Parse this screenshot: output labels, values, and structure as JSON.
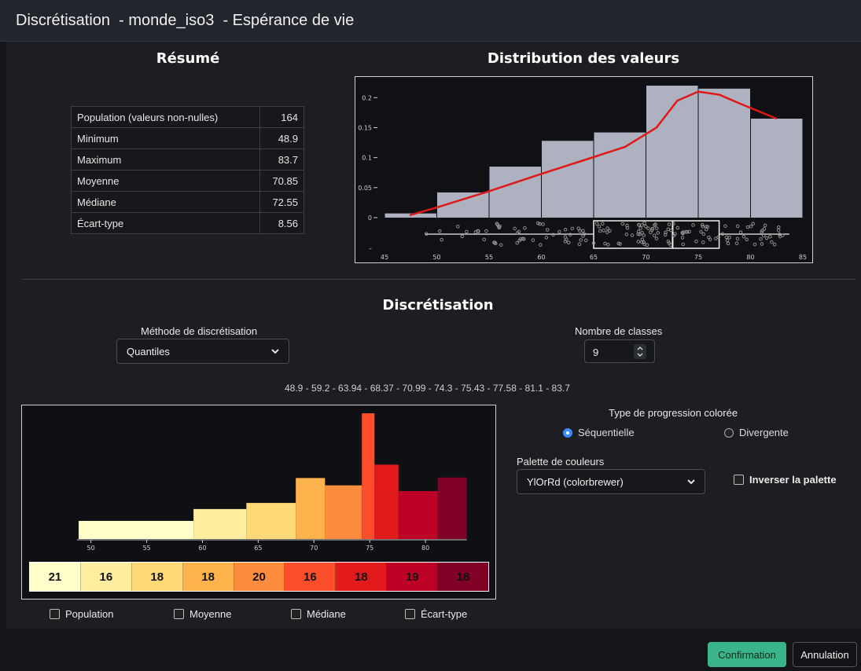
{
  "dialog": {
    "title": "Discrétisation  - monde_iso3  - Espérance de vie"
  },
  "summary": {
    "heading": "Résumé",
    "rows": [
      {
        "label": "Population (valeurs non-nulles)",
        "value": "164"
      },
      {
        "label": "Minimum",
        "value": "48.9"
      },
      {
        "label": "Maximum",
        "value": "83.7"
      },
      {
        "label": "Moyenne",
        "value": "70.85"
      },
      {
        "label": "Médiane",
        "value": "72.55"
      },
      {
        "label": "Écart-type",
        "value": "8.56"
      }
    ]
  },
  "distribution": {
    "heading": "Distribution des valeurs",
    "chart_data": {
      "type": "bar",
      "bins": [
        [
          45,
          50
        ],
        [
          50,
          55
        ],
        [
          55,
          60
        ],
        [
          60,
          65
        ],
        [
          65,
          70
        ],
        [
          70,
          75
        ],
        [
          75,
          80
        ],
        [
          80,
          85
        ]
      ],
      "values": [
        0.007,
        0.042,
        0.085,
        0.128,
        0.142,
        0.22,
        0.215,
        0.165
      ],
      "density_curve": [
        [
          47.4,
          0.004
        ],
        [
          50,
          0.017
        ],
        [
          55,
          0.044
        ],
        [
          60,
          0.073
        ],
        [
          65,
          0.101
        ],
        [
          68,
          0.118
        ],
        [
          71,
          0.15
        ],
        [
          73,
          0.195
        ],
        [
          75,
          0.21
        ],
        [
          77,
          0.205
        ],
        [
          79,
          0.19
        ],
        [
          82.5,
          0.165
        ]
      ],
      "x_ticks": [
        45,
        50,
        55,
        60,
        65,
        70,
        75,
        80,
        85
      ],
      "y_ticks": [
        "0",
        "0.05",
        "0.1",
        "0.15",
        "0.2"
      ],
      "xlim": [
        45,
        85
      ],
      "ylim": [
        0,
        0.22
      ],
      "boxplot": {
        "whisker_low": 48.9,
        "q1": 65,
        "median": 72.55,
        "q3": 77,
        "whisker_high": 83.7
      },
      "colors": {
        "bars": "#aeb1c0",
        "curve": "#e01818"
      }
    }
  },
  "discretization": {
    "heading": "Discrétisation",
    "method_label": "Méthode de discrétisation",
    "method_value": "Quantiles",
    "classes_label": "Nombre de classes",
    "classes_value": "9",
    "breaks_text": "48.9 - 59.2 - 63.94 - 68.37 - 70.99 - 74.3 - 75.43 - 77.58 - 81.1 - 83.7",
    "chart_data": {
      "type": "bar",
      "breaks": [
        48.9,
        59.2,
        63.94,
        68.37,
        70.99,
        74.3,
        75.43,
        77.58,
        81.1,
        83.7
      ],
      "counts": [
        21,
        16,
        18,
        18,
        20,
        16,
        18,
        19,
        18
      ],
      "colors": [
        "#ffffcc",
        "#ffeda0",
        "#fed976",
        "#feb24c",
        "#fd8d3c",
        "#fc4e2a",
        "#e31a1c",
        "#bd0026",
        "#800026"
      ],
      "x_ticks": [
        50,
        55,
        60,
        65,
        70,
        75,
        80
      ],
      "xlim": [
        46.5,
        85
      ]
    },
    "checkboxes": [
      "Population",
      "Moyenne",
      "Médiane",
      "Écart-type"
    ]
  },
  "color": {
    "progression_label": "Type de progression colorée",
    "sequential": "Séquentielle",
    "divergent": "Divergente",
    "palette_label": "Palette de couleurs",
    "palette_value": "YlOrRd (colorbrewer)",
    "invert_label": "Inverser la palette"
  },
  "actions": {
    "confirm": "Confirmation",
    "cancel": "Annulation"
  }
}
